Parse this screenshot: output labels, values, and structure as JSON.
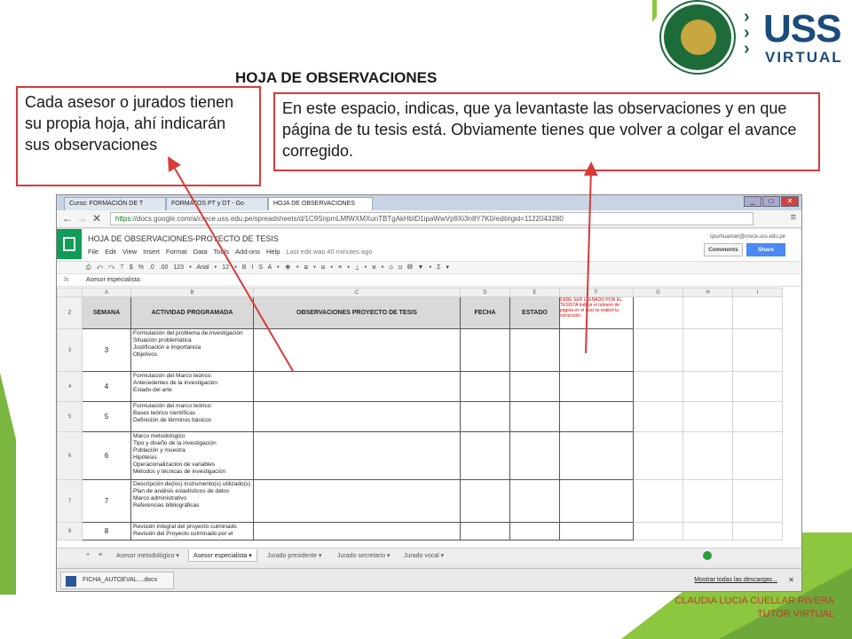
{
  "slide": {
    "title": "HOJA DE OBSERVACIONES",
    "callout_left": "Cada asesor o jurados tienen su propia hoja, ahí indicarán sus observaciones",
    "callout_right": "En este espacio, indicas, que ya levantaste las observaciones y en que página de tu tesis está. Obviamente tienes que volver a colgar el avance corregido.",
    "footer_name": "CLAUDIA LUCIA CUELLAR RIVERA",
    "footer_role": "TUTOR VIRTUAL",
    "logo_text": "USS",
    "logo_sub": "VIRTUAL",
    "accent_color": "#8dc63f",
    "callout_border_color": "#d93a3a"
  },
  "browser": {
    "tabs": [
      {
        "label": "Curso: FORMACIÓN DE T"
      },
      {
        "label": "FORMATOS PT y DT - Go"
      },
      {
        "label": "HOJA DE OBSERVACIONES"
      }
    ],
    "url_scheme": "https://",
    "url_rest": "docs.google.com/a/crece.uss.edu.pe/spreadsheets/d/1C9SnpmLMfWXMXunTBTgAkHbID1ipaWwVp9Xi3n8Y7K0/edit#gid=1122043280"
  },
  "doc": {
    "title": "HOJA DE OBSERVACIONES-PROYECTO DE TESIS",
    "menus": [
      "File",
      "Edit",
      "View",
      "Insert",
      "Format",
      "Data",
      "Tools",
      "Add-ons",
      "Help"
    ],
    "last_edit": "Last edit was 40 minutes ago",
    "account": "cpurhuaman@crece.uss.edu.pe",
    "comments_label": "Comments",
    "share_label": "Share",
    "toolbar_text": "⎙ ↶ ↷ ⊤  $ % .0 .00 123 ▾  Arial ▾  12 ▾  B I S A ▾  ◈ ▾ ⊞ ▾ ⊟ ▾  ≡ ▾ ⊥ ▾ ≣ ▾  ⊝ ⊡ ▥ ▼ ▾ Σ ▾",
    "formula_value": "Asesor especialista:",
    "col_headers": [
      "A",
      "B",
      "C",
      "D",
      "E",
      "F",
      "G",
      "H",
      "I"
    ],
    "header_row": {
      "rownum": "2",
      "semana": "SEMANA",
      "actividad": "ACTIVIDAD PROGRAMADA",
      "observaciones": "OBSERVACIONES PROYECTO DE TESIS",
      "fecha": "FECHA",
      "estado": "ESTADO",
      "f_note": "DEBE SER LLENADO POR EL TESISTA Indicar el número de página en el cual se realizó la corrección"
    },
    "rows": [
      {
        "rownum": "3",
        "semana": "3",
        "actividad": "Formulación del problema de investigación\nSituación problemática\nJustificación e importancia\nObjetivos"
      },
      {
        "rownum": "4",
        "semana": "4",
        "actividad": "Formulación del Marco teórico:\nAntecedentes de la investigación\nEstado del arte"
      },
      {
        "rownum": "5",
        "semana": "5",
        "actividad": "Formulación del marco teórico:\nBases teórico científicas\nDefinición de términos básicos"
      },
      {
        "rownum": "6",
        "semana": "6",
        "actividad": "Marco metodológico\nTipo y diseño de la investigación\nPoblación y muestra\nHipótesis\nOperacionalización de variables\nMétodos y técnicas de investigación"
      },
      {
        "rownum": "7",
        "semana": "7",
        "actividad": "Descripción de(los) instrumento(s) utilizado(s)\nPlan de análisis estadísticos de datos\nMarco administrativo\nReferencias bibliográficas"
      },
      {
        "rownum": "8",
        "semana": "8",
        "actividad": "Revisión integral del proyecto culminado\nRevisión del Proyecto culminado por el"
      }
    ],
    "sheet_tabs": [
      "Asesor metodológico",
      "Asesor especialista",
      "Jurado presidente",
      "Jurado secretario",
      "Jurado vocal"
    ],
    "active_sheet": "Asesor especialista"
  },
  "downloads": {
    "file": "FICHA_AUTOEVAL....docx",
    "show_all": "Mostrar todas las descargas..."
  }
}
